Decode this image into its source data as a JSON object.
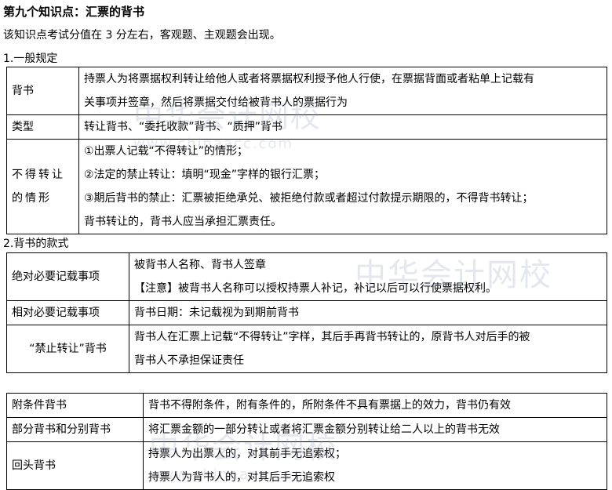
{
  "title": "第九个知识点：汇票的背书",
  "intro": "该知识点考试分值在 3 分左右，客观题、主观题会出现。",
  "section1": {
    "heading": "1.一般规定",
    "rows": [
      {
        "label": "背书",
        "lines": [
          "持票人为将票据权利转让给他人或者将票据权利授予他人行使，在票据背面或者粘单上记载有",
          "关事项并签章，然后将票据交付给被背书人的票据行为"
        ]
      },
      {
        "label": "类型",
        "lines": [
          "转让背书、“委托收款”背书、“质押”背书"
        ]
      },
      {
        "label": "不得转让的情形",
        "lines": [
          "①出票人记载“不得转让”的情形；",
          "②法定的禁止转让：填明“现金”字样的银行汇票；",
          "③期后背书的禁止：汇票被拒绝承兑、被拒绝付款或者超过付款提示期限的，不得背书转让；",
          "背书转让的，背书人应当承担汇票责任。"
        ]
      }
    ]
  },
  "section2": {
    "heading": "2.背书的款式",
    "rows": [
      {
        "label": "绝对必要记载事项",
        "lines": [
          "被背书人名称、背书人签章",
          "【注意】被背书人名称可以授权持票人补记，补记以后可以行使票据权利。"
        ]
      },
      {
        "label": "相对必要记载事项",
        "lines": [
          "背书日期：未记载视为到期前背书"
        ]
      },
      {
        "label": "“禁止转让”背书",
        "lines": [
          "背书人在汇票上记载“不得转让”字样，其后手再背书转让的，原背书人对后手的被",
          "背书人不承担保证责任"
        ]
      }
    ]
  },
  "section3": {
    "rows": [
      {
        "label": "附条件背书",
        "lines": [
          "背书不得附条件，附有条件的，所附条件不具有票据上的效力，背书仍有效"
        ]
      },
      {
        "label": "部分背书和分别背书",
        "lines": [
          "将汇票金额的一部分转让或者将汇票金额分别转让给二人以上的背书无效"
        ]
      },
      {
        "label": "回头背书",
        "lines": [
          "持票人为出票人的，对其前手无追索权；",
          "持票人为背书人的，对其后手无追索权"
        ]
      }
    ]
  },
  "watermark": {
    "name": "中华会计网校",
    "url": "www.chinaacc.com"
  }
}
